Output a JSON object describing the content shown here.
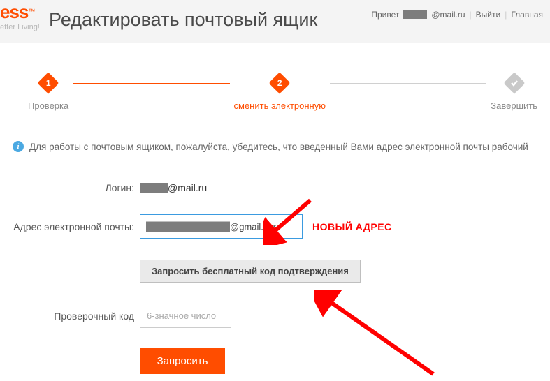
{
  "header": {
    "logo_fragment": "ess",
    "logo_tagline": "etter Living!",
    "title": "Редактировать почтовый ящик",
    "greeting_prefix": "Привет",
    "greeting_email_suffix": "@mail.ru",
    "logout": "Выйти",
    "home": "Главная"
  },
  "steps": {
    "s1": {
      "num": "1",
      "label": "Проверка"
    },
    "s2": {
      "num": "2",
      "label": "сменить электронную"
    },
    "s3": {
      "label": "Завершить"
    }
  },
  "info": {
    "text": "Для работы с почтовым ящиком, пожалуйста, убедитесь, что введенный Вами адрес электронной почты рабочий"
  },
  "form": {
    "login_label": "Логин:",
    "login_suffix": "@mail.ru",
    "email_label": "Адрес электронной почты:",
    "email_value_suffix": "@gmail.cor",
    "email_annotation": "НОВЫЙ АДРЕС",
    "request_code_btn": "Запросить бесплатный код подтверждения",
    "code_label": "Проверочный код",
    "code_placeholder": "6-значное число",
    "submit_btn": "Запросить"
  }
}
